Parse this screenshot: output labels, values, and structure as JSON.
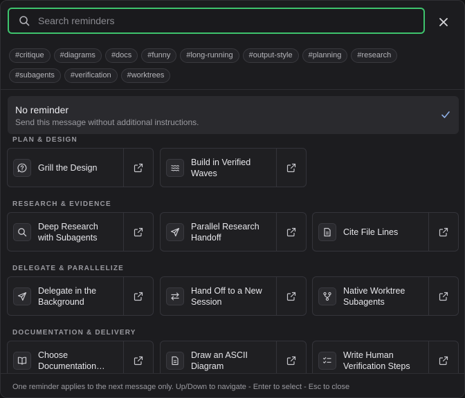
{
  "search": {
    "placeholder": "Search reminders"
  },
  "tags": [
    "#critique",
    "#diagrams",
    "#docs",
    "#funny",
    "#long-running",
    "#output-style",
    "#planning",
    "#research",
    "#subagents",
    "#verification",
    "#worktrees"
  ],
  "no_reminder": {
    "title": "No reminder",
    "subtitle": "Send this message without additional instructions."
  },
  "sections": [
    {
      "title": "PLAN & DESIGN",
      "cards": [
        {
          "label": "Grill the Design",
          "icon": "question-icon"
        },
        {
          "label": "Build in Verified Waves",
          "icon": "waves-icon"
        }
      ]
    },
    {
      "title": "RESEARCH & EVIDENCE",
      "cards": [
        {
          "label": "Deep Research with Subagents",
          "icon": "search-icon"
        },
        {
          "label": "Parallel Research Handoff",
          "icon": "send-icon"
        },
        {
          "label": "Cite File Lines",
          "icon": "file-icon"
        }
      ]
    },
    {
      "title": "DELEGATE & PARALLELIZE",
      "cards": [
        {
          "label": "Delegate in the Background",
          "icon": "send-icon"
        },
        {
          "label": "Hand Off to a New Session",
          "icon": "swap-icon"
        },
        {
          "label": "Native Worktree Subagents",
          "icon": "git-branch-icon"
        }
      ]
    },
    {
      "title": "DOCUMENTATION & DELIVERY",
      "cards": [
        {
          "label": "Choose Documentation Surface",
          "icon": "book-icon"
        },
        {
          "label": "Draw an ASCII Diagram",
          "icon": "file-icon"
        },
        {
          "label": "Write Human Verification Steps",
          "icon": "checklist-icon"
        }
      ]
    }
  ],
  "footer": {
    "text": "One reminder applies to the next message only. Up/Down to navigate - Enter to select - Esc to close"
  },
  "colors": {
    "accent": "#3ec46d",
    "background": "#1c1c1f",
    "selected_row": "#2a2a2e"
  }
}
